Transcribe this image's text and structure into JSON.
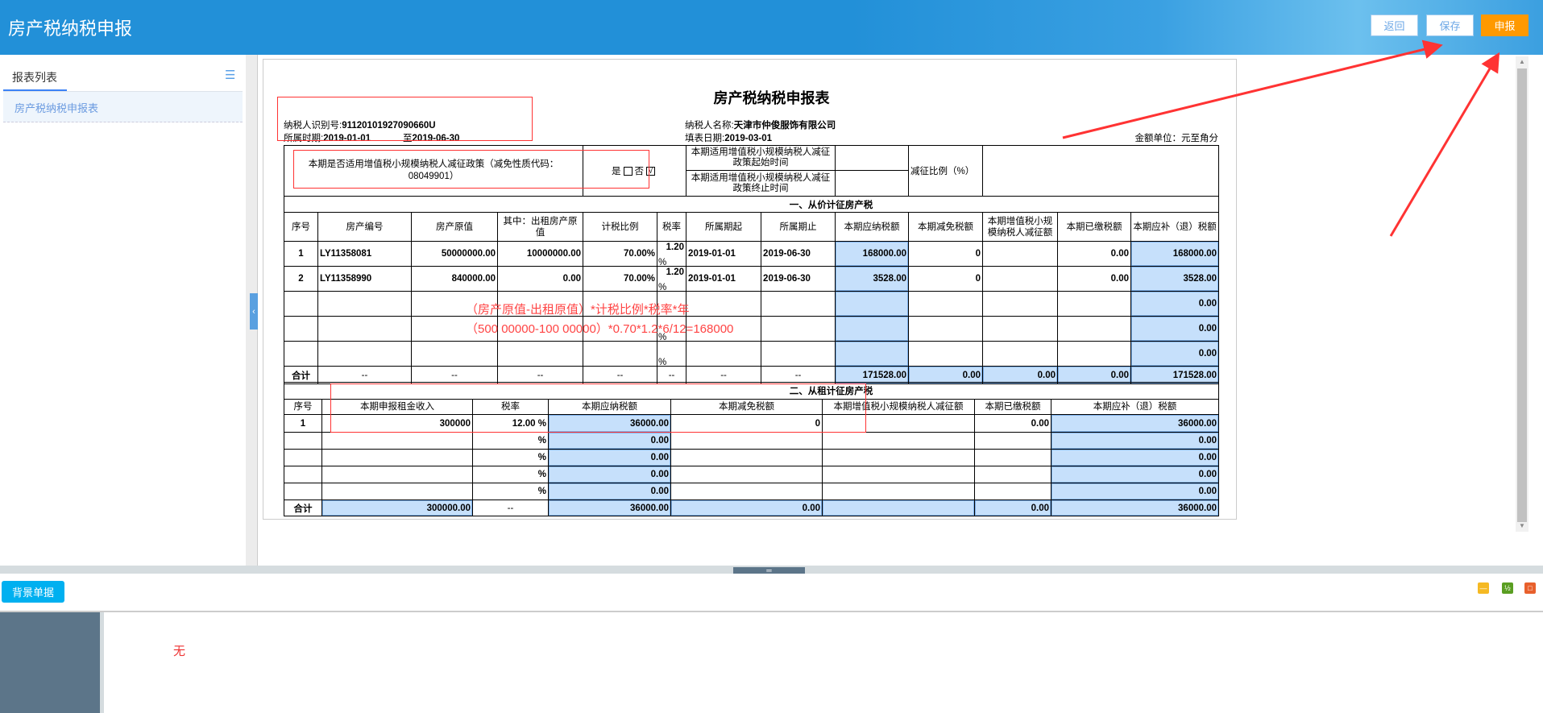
{
  "header": {
    "title": "房产税纳税申报",
    "back": "返回",
    "save": "保存",
    "submit": "申报"
  },
  "sidebar": {
    "tab": "报表列表",
    "items": [
      "房产税纳税申报表"
    ]
  },
  "form": {
    "title": "房产税纳税申报表",
    "taxpayer_id_label": "纳税人识别号:",
    "taxpayer_id": "91120101927090660U",
    "period_label": "所属时期:",
    "period_start": "2019-01-01",
    "period_to": "至",
    "period_end": "2019-06-30",
    "taxpayer_name_label": "纳税人名称:",
    "taxpayer_name": "天津市仲俊服饰有限公司",
    "fill_date_label": "填表日期:",
    "fill_date": "2019-03-01",
    "unit": "金额单位：元至角分",
    "percent_sign": "%",
    "policy": {
      "question": "本期是否适用增值税小规模纳税人减征政策（减免性质代码：08049901）",
      "yes": "是",
      "no": "否",
      "no_mark": "√",
      "start_label": "本期适用增值税小规模纳税人减征政策起始时间",
      "end_label": "本期适用增值税小规模纳税人减征政策终止时间",
      "ratio_label": "减征比例（%）"
    },
    "section1": {
      "title": "一、从价计征房产税",
      "headers": [
        "序号",
        "房产编号",
        "房产原值",
        "其中：出租房产原值",
        "计税比例",
        "税率",
        "所属期起",
        "所属期止",
        "本期应纳税额",
        "本期减免税额",
        "本期增值税小规模纳税人减征额",
        "本期已缴税额",
        "本期应补（退）税额"
      ],
      "rows": [
        [
          "1",
          "LY11358081",
          "50000000.00",
          "10000000.00",
          "70.00%",
          "1.20",
          "2019-01-01",
          "2019-06-30",
          "168000.00",
          "0",
          "",
          "0.00",
          "168000.00"
        ],
        [
          "2",
          "LY11358990",
          "840000.00",
          "0.00",
          "70.00%",
          "1.20",
          "2019-01-01",
          "2019-06-30",
          "3528.00",
          "0",
          "",
          "0.00",
          "3528.00"
        ],
        [
          "",
          "",
          "",
          "",
          "",
          "",
          "",
          "",
          "",
          "",
          "",
          "",
          "0.00"
        ],
        [
          "",
          "",
          "",
          "",
          "",
          "",
          "",
          "",
          "",
          "",
          "",
          "",
          "0.00"
        ],
        [
          "",
          "",
          "",
          "",
          "",
          "",
          "",
          "",
          "",
          "",
          "",
          "",
          "0.00"
        ]
      ],
      "total": [
        "合计",
        "--",
        "--",
        "--",
        "--",
        "--",
        "--",
        "--",
        "171528.00",
        "0.00",
        "0.00",
        "0.00",
        "171528.00"
      ]
    },
    "section2": {
      "title": "二、从租计征房产税",
      "headers": [
        "序号",
        "本期申报租金收入",
        "税率",
        "本期应纳税额",
        "本期减免税额",
        "本期增值税小规模纳税人减征额",
        "本期已缴税额",
        "本期应补（退）税额"
      ],
      "rows": [
        [
          "1",
          "300000",
          "12.00",
          "36000.00",
          "0",
          "",
          "0.00",
          "36000.00"
        ],
        [
          "",
          "",
          "",
          "0.00",
          "",
          "",
          "",
          "0.00"
        ],
        [
          "",
          "",
          "",
          "0.00",
          "",
          "",
          "",
          "0.00"
        ],
        [
          "",
          "",
          "",
          "0.00",
          "",
          "",
          "",
          "0.00"
        ],
        [
          "",
          "",
          "",
          "0.00",
          "",
          "",
          "",
          "0.00"
        ]
      ],
      "total": [
        "合计",
        "300000.00",
        "--",
        "36000.00",
        "0.00",
        "",
        "0.00",
        "36000.00"
      ]
    }
  },
  "annotation": {
    "line1": "（房产原值-出租原值）*计税比例*税率*年",
    "line2": "（500 00000-100 00000）*0.70*1.2*6/12=168000"
  },
  "bottom": {
    "tab_button": "背景单据",
    "content": "无"
  }
}
